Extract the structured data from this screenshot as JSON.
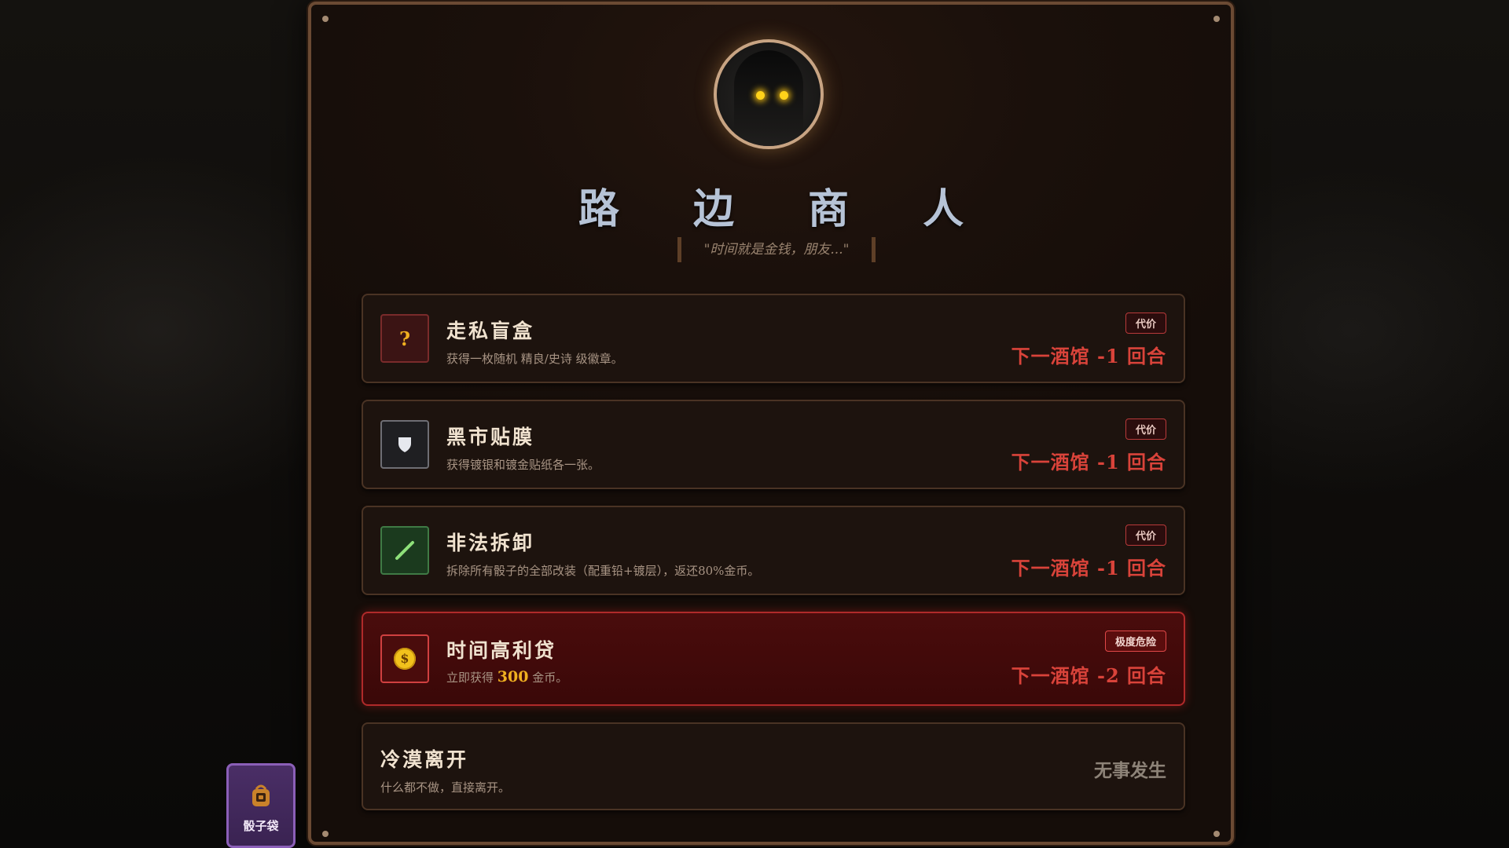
{
  "merchant": {
    "name": "路 边 商 人",
    "quote": "\"时间就是金钱，朋友...\""
  },
  "options": [
    {
      "title": "走私盲盒",
      "description": "获得一枚随机 精良/史诗 级徽章。",
      "badge": "代价",
      "cost": "下一酒馆 -1 回合",
      "icon": "question-mark-icon",
      "icon_glyph": "?"
    },
    {
      "title": "黑市贴膜",
      "description": "获得镀银和镀金贴纸各一张。",
      "badge": "代价",
      "cost": "下一酒馆 -1 回合",
      "icon": "shield-icon"
    },
    {
      "title": "非法拆卸",
      "description": "拆除所有骰子的全部改装（配重铅+镀层），返还80%金币。",
      "badge": "代价",
      "cost": "下一酒馆 -1 回合",
      "icon": "slash-tool-icon"
    },
    {
      "title": "时间高利贷",
      "description_prefix": "立即获得",
      "description_amount": "300",
      "description_suffix": "金币。",
      "badge": "极度危险",
      "cost": "下一酒馆 -2 回合",
      "icon": "gold-coin-icon",
      "icon_glyph": "$"
    }
  ],
  "leave": {
    "title": "冷漠离开",
    "description": "什么都不做，直接离开。",
    "result": "无事发生"
  },
  "dice_bag": {
    "label": "骰子袋",
    "icon": "bag-icon"
  },
  "colors": {
    "cost_red": "#d9433a",
    "danger_border": "#b02a2a",
    "gold": "#f0b020",
    "title_blue": "#b6c3d6"
  }
}
